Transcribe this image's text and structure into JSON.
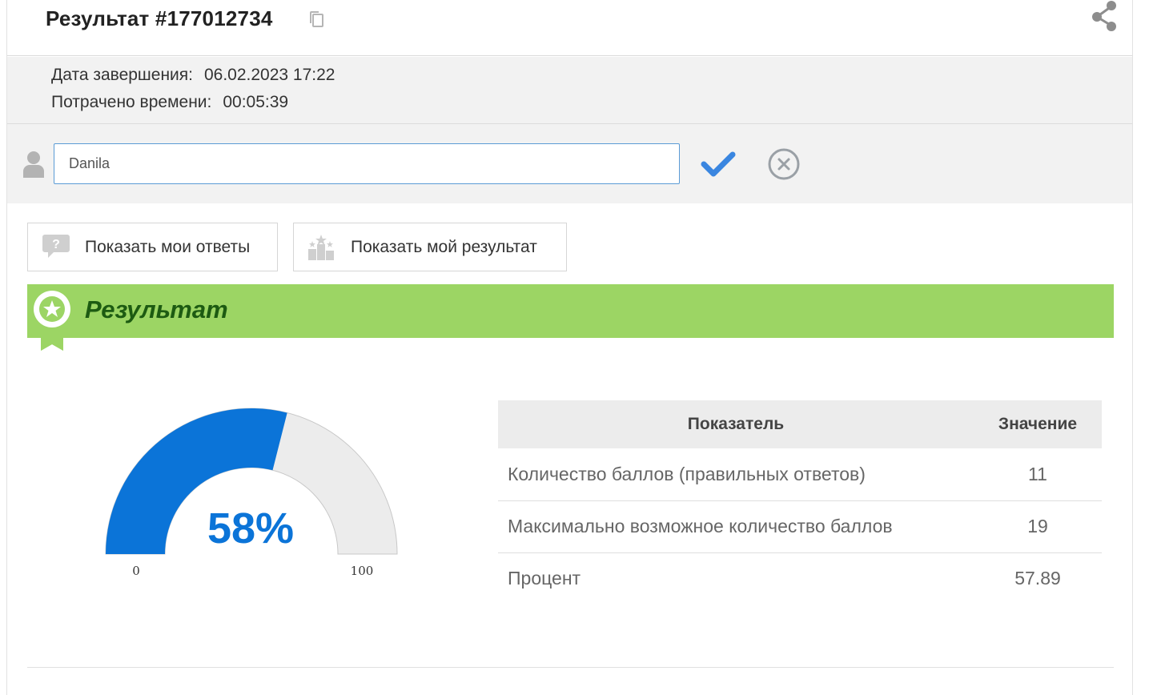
{
  "header": {
    "title": "Результат #177012734"
  },
  "meta": {
    "completion_label": "Дата завершения:",
    "completion_value": "06.02.2023 17:22",
    "time_label": "Потрачено времени:",
    "time_value": "00:05:39"
  },
  "name_field": {
    "value": "Danila"
  },
  "buttons": {
    "show_answers": "Показать мои ответы",
    "show_result": "Показать мой результат"
  },
  "result": {
    "title": "Результат"
  },
  "gauge": {
    "percent_label": "58%",
    "value": 57.89,
    "min": 0,
    "max": 100,
    "min_label": "0",
    "max_label": "100",
    "fill_color": "#0b74d8",
    "track_color": "#ececec"
  },
  "table": {
    "headers": [
      "Показатель",
      "Значение"
    ],
    "rows": [
      {
        "label": "Количество баллов (правильных ответов)",
        "value": "11"
      },
      {
        "label": "Максимально возможное количество баллов",
        "value": "19"
      },
      {
        "label": "Процент",
        "value": "57.89"
      }
    ]
  },
  "colors": {
    "banner": "#9cd564",
    "banner_text": "#1d5b12",
    "check": "#3a86e0",
    "accent": "#0b74d8"
  }
}
